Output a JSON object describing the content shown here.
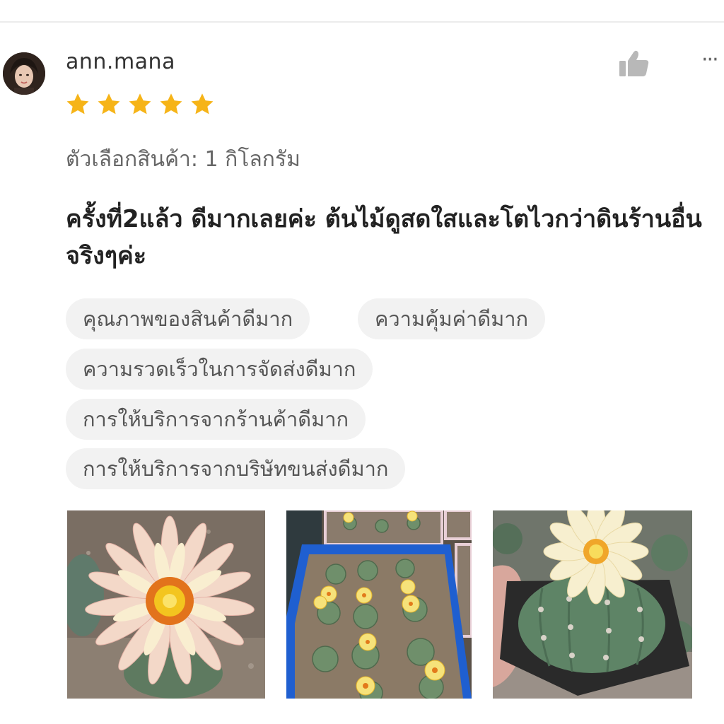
{
  "review": {
    "username": "ann.mana",
    "rating": 5,
    "rating_max": 5,
    "variation": "ตัวเลือกสินค้า: 1 กิโลกรัม",
    "comment": "ครั้งที่2แล้ว ดีมากเลยค่ะ ต้นไม้ดูสดใสและโตไวกว่าดินร้านอื่นจริงๆค่ะ",
    "more_label": "···",
    "tags": [
      "คุณภาพของสินค้าดีมาก",
      "ความคุ้มค่าดีมาก",
      "ความรวดเร็วในการจัดส่งดีมาก",
      "การให้บริการจากร้านค้าดีมาก",
      "การให้บริการจากบริษัทขนส่งดีมาก"
    ],
    "photos": [
      "cactus-flower-closeup-photo",
      "cactus-tray-photo",
      "cactus-pot-in-hand-photo"
    ]
  },
  "colors": {
    "star": "#f6b418",
    "tag_bg": "#f2f2f2",
    "like_icon": "#b8b8b8",
    "divider": "#ececec"
  },
  "icons": {
    "like": "thumbs-up-icon",
    "more": "more-dots-icon",
    "star": "star-icon"
  }
}
